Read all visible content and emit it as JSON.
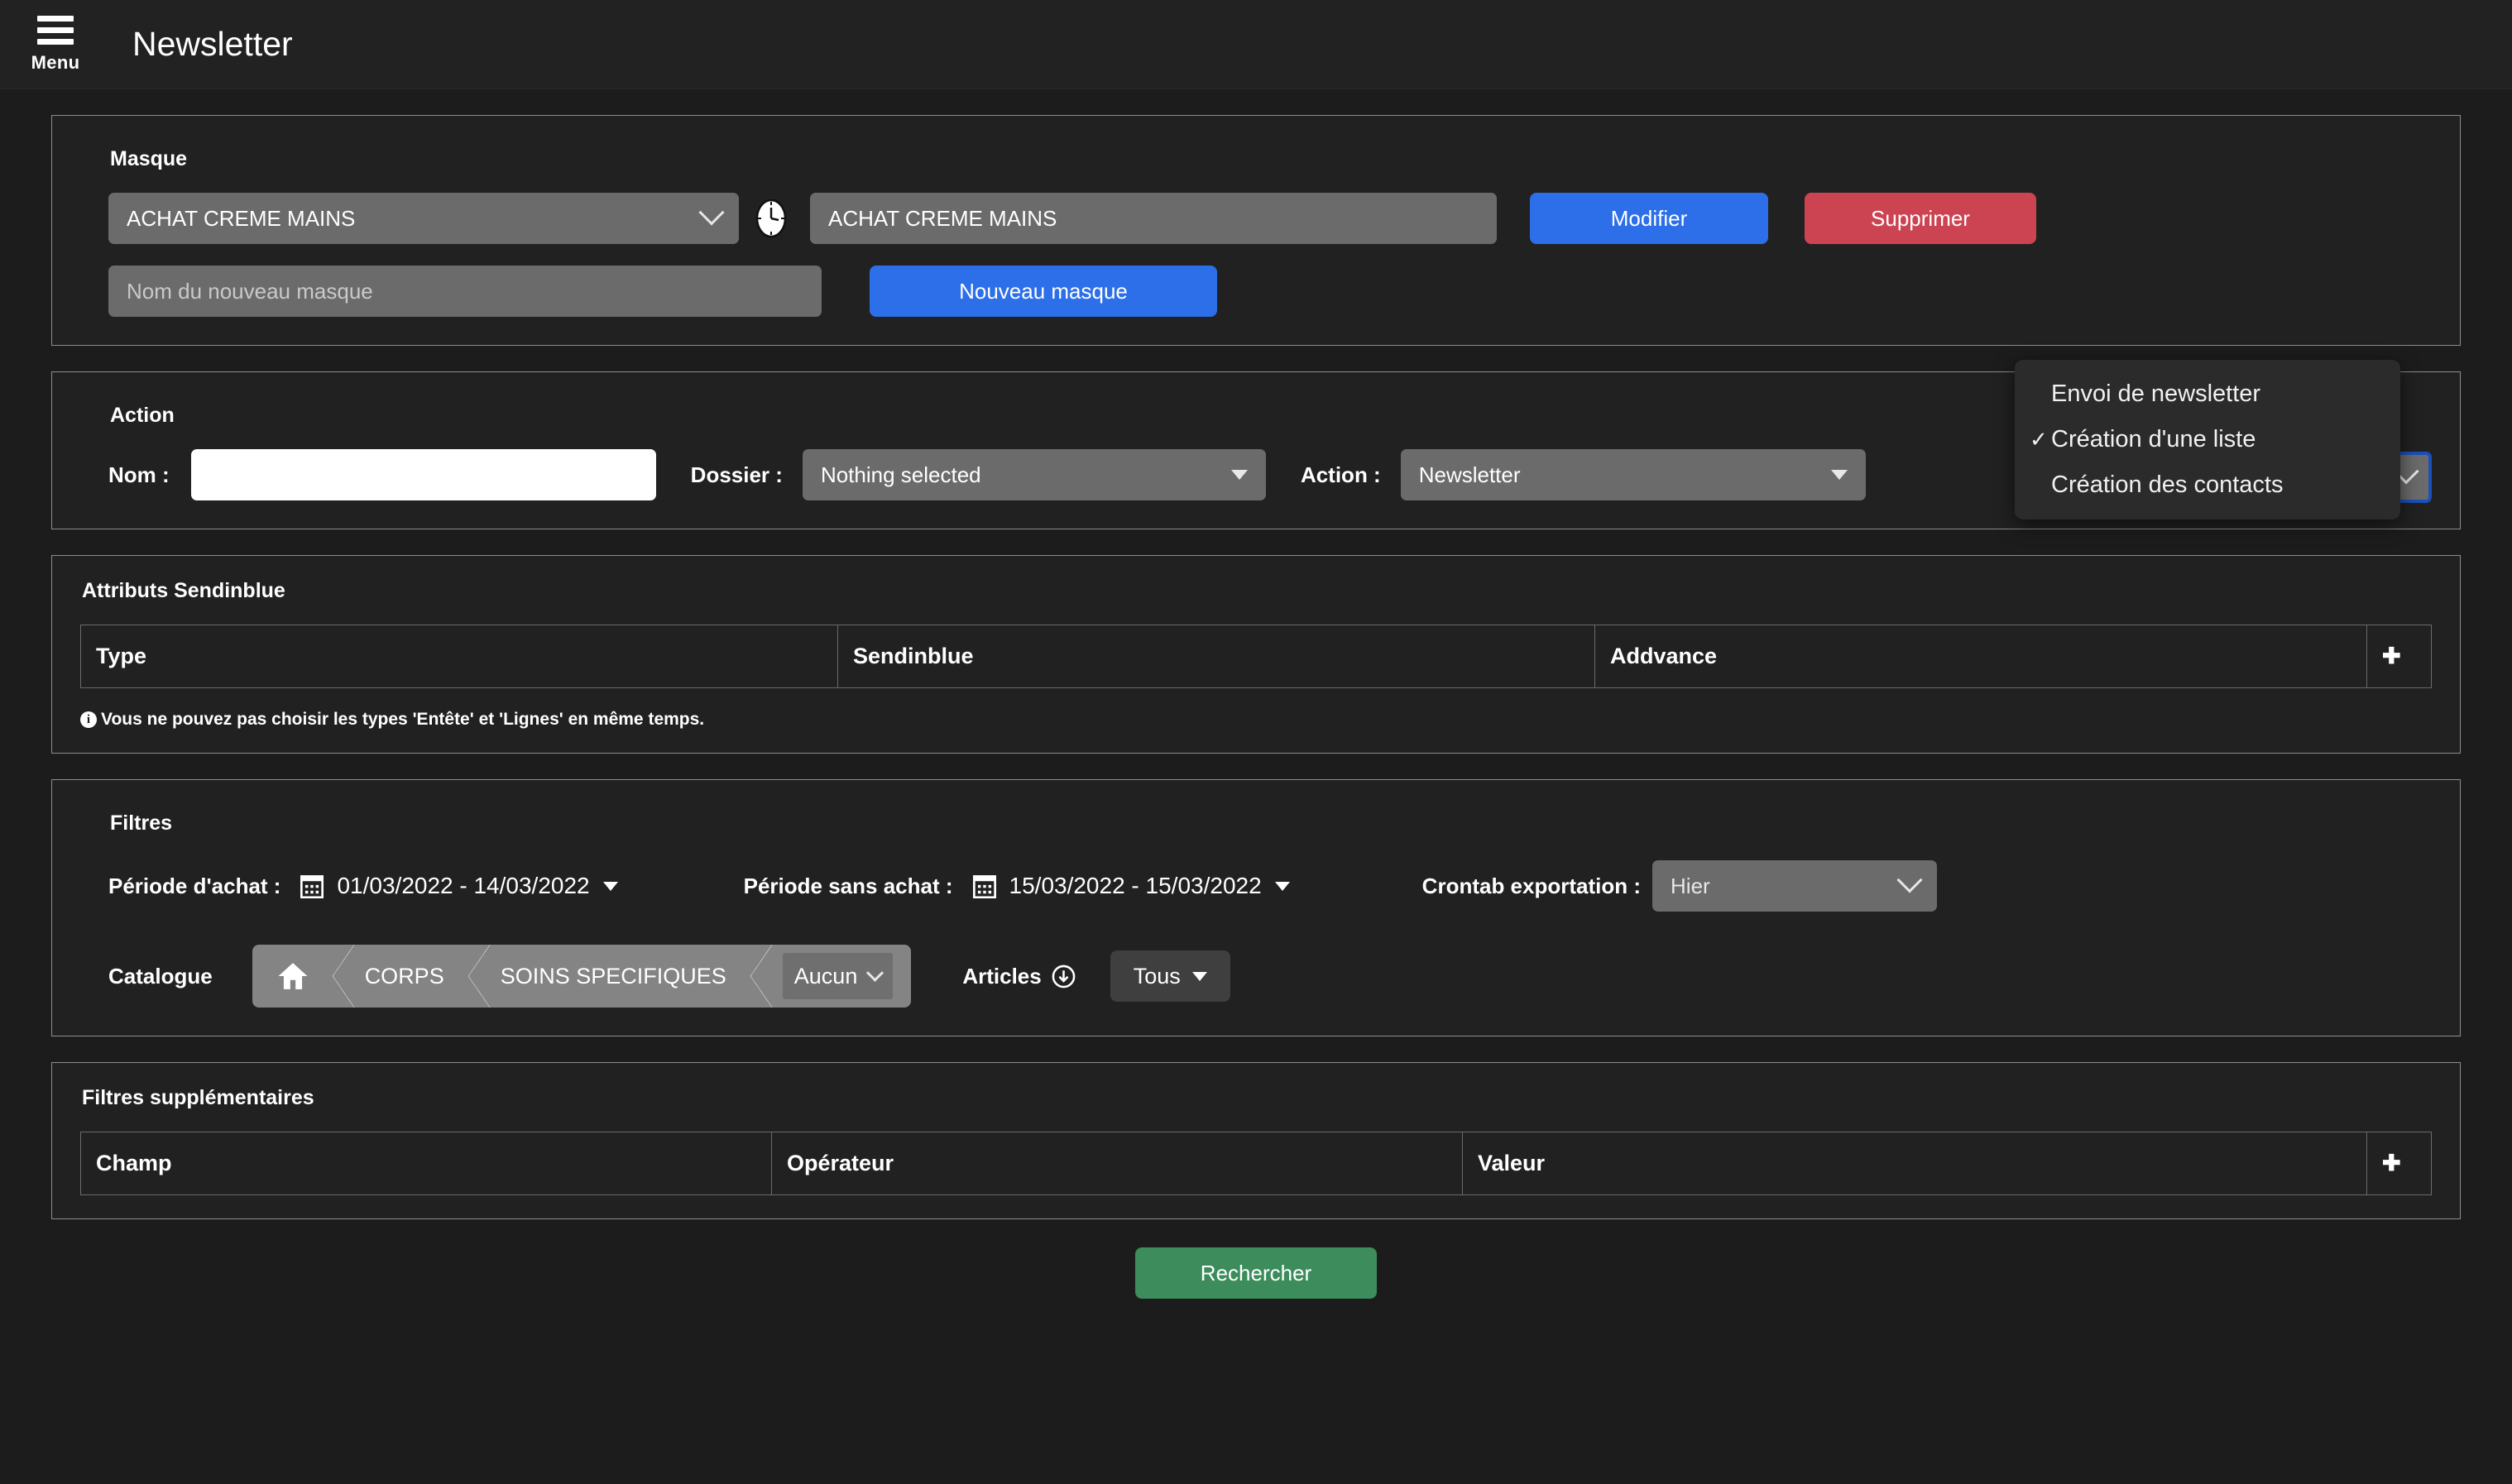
{
  "header": {
    "menu_label": "Menu",
    "title": "Newsletter",
    "menu_icon": "hamburger-icon"
  },
  "masque": {
    "title": "Masque",
    "select_value": "ACHAT CREME MAINS",
    "clock_icon": "clock-icon",
    "name_value": "ACHAT CREME MAINS",
    "edit_button": "Modifier",
    "delete_button": "Supprimer",
    "new_placeholder": "Nom du nouveau masque",
    "new_button": "Nouveau masque"
  },
  "action": {
    "title": "Action",
    "nom_label": "Nom :",
    "nom_value": "",
    "dossier_label": "Dossier :",
    "dossier_value": "Nothing selected",
    "action_label": "Action :",
    "action_value": "Newsletter",
    "menu": {
      "items": [
        {
          "label": "Envoi de newsletter",
          "checked": false
        },
        {
          "label": "Création d'une liste",
          "checked": true
        },
        {
          "label": "Création des contacts",
          "checked": false
        }
      ],
      "check_glyph": "✓"
    }
  },
  "attributs": {
    "title": "Attributs Sendinblue",
    "columns": [
      "Type",
      "Sendinblue",
      "Addvance"
    ],
    "add_glyph": "✚",
    "note": "Vous ne pouvez pas choisir les types 'Entête' et 'Lignes' en même temps.",
    "note_icon": "info-icon",
    "note_icon_glyph": "i"
  },
  "filtres": {
    "title": "Filtres",
    "periode_achat_label": "Période d'achat :",
    "periode_achat_value": "01/03/2022 - 14/03/2022",
    "periode_sans_achat_label": "Période sans achat :",
    "periode_sans_achat_value": "15/03/2022 - 15/03/2022",
    "crontab_label": "Crontab exportation :",
    "crontab_value": "Hier",
    "catalogue_label": "Catalogue",
    "breadcrumb": [
      {
        "label": "",
        "icon": "home-icon"
      },
      {
        "label": "CORPS",
        "icon": ""
      },
      {
        "label": "SOINS SPECIFIQUES",
        "icon": ""
      }
    ],
    "breadcrumb_select": "Aucun",
    "articles_label": "Articles",
    "articles_icon": "download-circle-icon",
    "articles_button": "Tous"
  },
  "filtres_supp": {
    "title": "Filtres supplémentaires",
    "columns": [
      "Champ",
      "Opérateur",
      "Valeur"
    ],
    "add_glyph": "✚"
  },
  "footer": {
    "search_button": "Rechercher"
  },
  "colors": {
    "primary": "#2c6fe8",
    "danger": "#cc4452",
    "success": "#3c8c5c",
    "panel_bg": "#212121",
    "page_bg": "#1c1c1c",
    "field_bg": "#6b6b6b"
  }
}
